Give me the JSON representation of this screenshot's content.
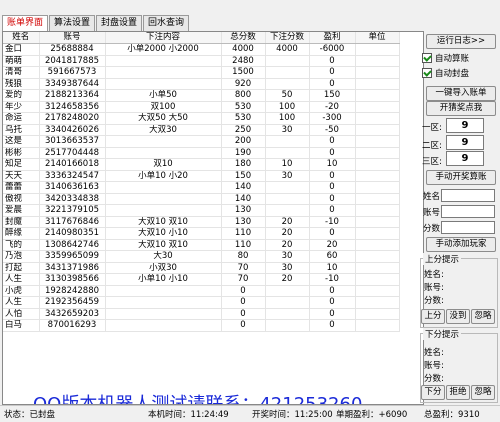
{
  "tabs": [
    "账单界面",
    "算法设置",
    "封盘设置",
    "回水查询"
  ],
  "columns": [
    "姓名",
    "账号",
    "下注内容",
    "总分数",
    "下注分数",
    "盈利",
    "单位"
  ],
  "rows": [
    [
      "金口",
      "25688884",
      "小单2000 小2000",
      "4000",
      "4000",
      "-6000",
      ""
    ],
    [
      "萌萌",
      "2041817885",
      "",
      "2480",
      "",
      "0",
      ""
    ],
    [
      "清哥",
      "591667573",
      "",
      "1500",
      "",
      "0",
      ""
    ],
    [
      "残狼",
      "3349387644",
      "",
      "920",
      "",
      "0",
      ""
    ],
    [
      "爱的",
      "2188213364",
      "小单50",
      "800",
      "50",
      "150",
      ""
    ],
    [
      "年少",
      "3124658356",
      "双100",
      "530",
      "100",
      "-20",
      ""
    ],
    [
      "命运",
      "2178248020",
      "大双50 大50",
      "530",
      "100",
      "-300",
      ""
    ],
    [
      "乌托",
      "3340426026",
      "大双30",
      "250",
      "30",
      "-50",
      ""
    ],
    [
      "这是",
      "3013663537",
      "",
      "200",
      "",
      "0",
      ""
    ],
    [
      "彬彬",
      "2517704448",
      "",
      "190",
      "",
      "0",
      ""
    ],
    [
      "知足",
      "2140166018",
      "双10",
      "180",
      "10",
      "10",
      ""
    ],
    [
      "天天",
      "3336324547",
      "小单10 小20",
      "150",
      "30",
      "0",
      ""
    ],
    [
      "蕾蕾",
      "3140636163",
      "",
      "140",
      "",
      "0",
      ""
    ],
    [
      "傲视",
      "3420334838",
      "",
      "140",
      "",
      "0",
      ""
    ],
    [
      "爱晨",
      "3221379105",
      "",
      "130",
      "",
      "0",
      ""
    ],
    [
      "封魔",
      "3117676846",
      "大双10 双10",
      "130",
      "20",
      "-10",
      ""
    ],
    [
      "醉缘",
      "2140980351",
      "大双10 小10",
      "110",
      "20",
      "0",
      ""
    ],
    [
      "飞的",
      "1308642746",
      "大双10 双10",
      "110",
      "20",
      "20",
      ""
    ],
    [
      "乃泡",
      "3359965099",
      "大30",
      "80",
      "30",
      "60",
      ""
    ],
    [
      "打起",
      "3431371986",
      "小双30",
      "70",
      "30",
      "10",
      ""
    ],
    [
      "人生",
      "3130398566",
      "小单10 小10",
      "70",
      "20",
      "-10",
      ""
    ],
    [
      "小虎",
      "1928242880",
      "",
      "0",
      "",
      "0",
      ""
    ],
    [
      "人生",
      "2192356459",
      "",
      "0",
      "",
      "0",
      ""
    ],
    [
      "人怕",
      "3432659203",
      "",
      "0",
      "",
      "0",
      ""
    ],
    [
      "白马",
      "870016293",
      "",
      "0",
      "",
      "0",
      ""
    ]
  ],
  "overlay": "QQ版本机器人测试请联系：421253260",
  "right": {
    "log_btn": "运行日志>>",
    "auto_calc": "自动算账",
    "auto_seal": "自动封盘",
    "import_btn": "一键导入账单",
    "lottery_btn": "开猜奖点我",
    "zone1_label": "一区:",
    "zone1_val": "9",
    "zone2_label": "二区:",
    "zone2_val": "9",
    "zone3_label": "三区:",
    "zone3_val": "9",
    "open_bill_btn": "手动开奖算账",
    "name_label": "姓名:",
    "account_label": "账号:",
    "score_label": "分数:",
    "add_player_btn": "手动添加玩家",
    "up_group": "上分提示",
    "up_name": "姓名:",
    "up_account": "账号:",
    "up_score": "分数:",
    "up_btn": "上分",
    "up_reject": "没到",
    "up_ignore": "忽略",
    "down_group": "下分提示",
    "down_name": "姓名:",
    "down_account": "账号:",
    "down_score": "分数:",
    "down_btn": "下分",
    "down_reject": "拒绝",
    "down_ignore": "忽略"
  },
  "status": {
    "state": "状态：已封盘",
    "local_time": "本机时间：11:24:49",
    "open_time": "开奖时间：11:25:00",
    "period_profit": "单期盈利：+6090",
    "total_profit": "总盈利：9310"
  }
}
